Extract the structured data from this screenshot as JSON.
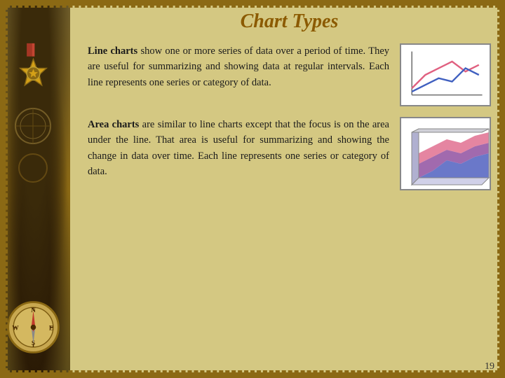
{
  "page": {
    "title": "Chart Types",
    "page_number": "19",
    "background_color": "#d4c882",
    "accent_color": "#8b5a00"
  },
  "sections": [
    {
      "id": "line-charts",
      "term": "Line charts",
      "text": " show one or more series of data over a period of time. They are useful for summarizing and showing data at regular intervals. Each line represents one series or category of data.",
      "chart_type": "line"
    },
    {
      "id": "area-charts",
      "term": "Area charts",
      "text": " are similar to line charts except that the focus is on the area under the line. That area is useful for summarizing and showing the change in data over time. Each line represents one series or category of data.",
      "chart_type": "area"
    }
  ]
}
